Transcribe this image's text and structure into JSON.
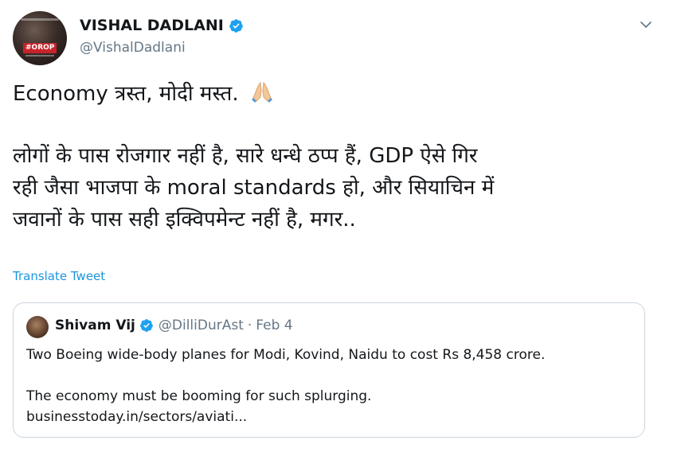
{
  "author": {
    "name": "VISHAL DADLANI",
    "handle": "@VishalDadlani",
    "avatar_tag": "#OROP",
    "verified_icon": "verified-badge-icon"
  },
  "menu": {
    "icon": "chevron-down-icon"
  },
  "tweet": {
    "line1": "Economy त्रस्त, मोदी मस्त.",
    "emoji": "folded-hands-icon",
    "line2": "लोगों के पास रोजगार नहीं है, सारे धन्धे ठप्प हैं,  GDP ऐसे गिर",
    "line3": "रही जैसा भाजपा के moral standards हो, और सियाचिन में",
    "line4": "जवानों के पास सही इक्विपमेन्ट नहीं है, मगर.."
  },
  "translate_label": "Translate Tweet",
  "quoted": {
    "name": "Shivam Vij",
    "handle": "@DilliDurAst",
    "separator": "·",
    "date": "Feb 4",
    "text1": "Two Boeing wide-body planes for Modi, Kovind, Naidu to cost Rs 8,458 crore.",
    "text2": "The economy must be booming for such splurging.",
    "link": "businesstoday.in/sectors/aviati..."
  },
  "colors": {
    "accent": "#1b95e0",
    "verified": "#1da1f2",
    "secondary_text": "#657786",
    "border": "#ccd6dd"
  }
}
